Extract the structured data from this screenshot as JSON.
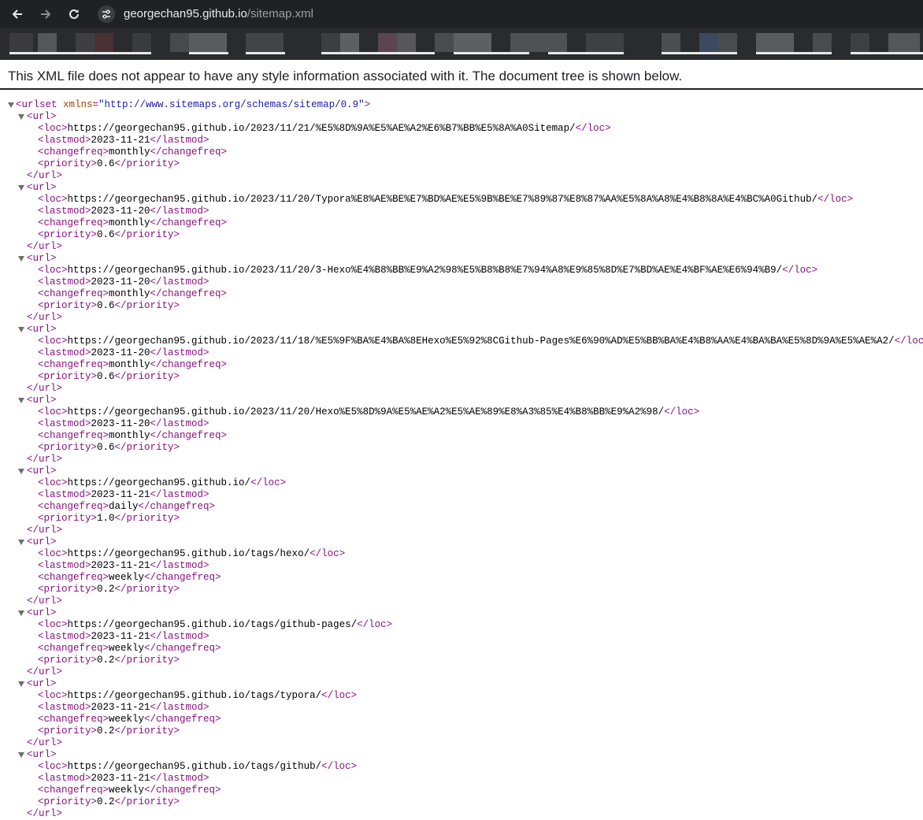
{
  "browser": {
    "url_host": "georgechan95.github.io",
    "url_path": "/sitemap.xml"
  },
  "infobar": {
    "message": "This XML file does not appear to have any style information associated with it. The document tree is shown below."
  },
  "xml": {
    "root_tag": "urlset",
    "root_attr_name": "xmlns",
    "root_attr_value": "\"http://www.sitemaps.org/schemas/sitemap/0.9\"",
    "entries": [
      {
        "loc": "https://georgechan95.github.io/2023/11/21/%E5%8D%9A%E5%AE%A2%E6%B7%BB%E5%8A%A0Sitemap/",
        "lastmod": "2023-11-21",
        "changefreq": "monthly",
        "priority": "0.6"
      },
      {
        "loc": "https://georgechan95.github.io/2023/11/20/Typora%E8%AE%BE%E7%BD%AE%E5%9B%BE%E7%89%87%E8%87%AA%E5%8A%A8%E4%B8%8A%E4%BC%A0Github/",
        "lastmod": "2023-11-20",
        "changefreq": "monthly",
        "priority": "0.6"
      },
      {
        "loc": "https://georgechan95.github.io/2023/11/20/3-Hexo%E4%B8%BB%E9%A2%98%E5%B8%B8%E7%94%A8%E9%85%8D%E7%BD%AE%E4%BF%AE%E6%94%B9/",
        "lastmod": "2023-11-20",
        "changefreq": "monthly",
        "priority": "0.6"
      },
      {
        "loc": "https://georgechan95.github.io/2023/11/18/%E5%9F%BA%E4%BA%8EHexo%E5%92%8CGithub-Pages%E6%90%AD%E5%BB%BA%E4%B8%AA%E4%BA%BA%E5%8D%9A%E5%AE%A2/",
        "lastmod": "2023-11-20",
        "changefreq": "monthly",
        "priority": "0.6"
      },
      {
        "loc": "https://georgechan95.github.io/2023/11/20/Hexo%E5%8D%9A%E5%AE%A2%E5%AE%89%E8%A3%85%E4%B8%BB%E9%A2%98/",
        "lastmod": "2023-11-20",
        "changefreq": "monthly",
        "priority": "0.6"
      },
      {
        "loc": "https://georgechan95.github.io/",
        "lastmod": "2023-11-21",
        "changefreq": "daily",
        "priority": "1.0"
      },
      {
        "loc": "https://georgechan95.github.io/tags/hexo/",
        "lastmod": "2023-11-21",
        "changefreq": "weekly",
        "priority": "0.2"
      },
      {
        "loc": "https://georgechan95.github.io/tags/github-pages/",
        "lastmod": "2023-11-21",
        "changefreq": "weekly",
        "priority": "0.2"
      },
      {
        "loc": "https://georgechan95.github.io/tags/typora/",
        "lastmod": "2023-11-21",
        "changefreq": "weekly",
        "priority": "0.2"
      },
      {
        "loc": "https://georgechan95.github.io/tags/github/",
        "lastmod": "2023-11-21",
        "changefreq": "weekly",
        "priority": "0.2"
      }
    ]
  },
  "colors": {
    "toolbar_bg": "#202124",
    "bookmarks_bg": "#2a2b2e",
    "tag": "#881280",
    "attr_name": "#994500",
    "attr_value": "#1a1aa6"
  },
  "icons": [
    "back-arrow-icon",
    "forward-arrow-icon",
    "reload-icon",
    "site-settings-icon",
    "collapse-triangle-icon"
  ]
}
